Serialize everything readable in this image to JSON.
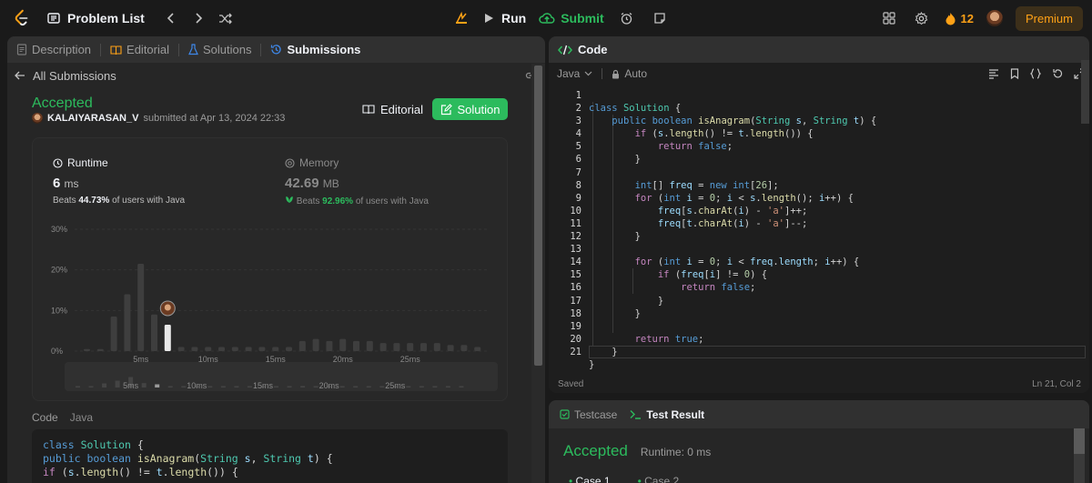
{
  "nav": {
    "problem_list": "Problem List",
    "run": "Run",
    "submit": "Submit",
    "streak": "12",
    "premium": "Premium"
  },
  "left_tabs": [
    "Description",
    "Editorial",
    "Solutions",
    "Submissions"
  ],
  "back_link": "All Submissions",
  "submission": {
    "status": "Accepted",
    "username": "KALAIYARASAN_V",
    "submitted_text": "submitted at Apr 13, 2024 22:33",
    "editorial_btn": "Editorial",
    "solution_btn": "Solution"
  },
  "runtime": {
    "label": "Runtime",
    "value": "6",
    "unit": "ms",
    "beats_prefix": "Beats",
    "beats_pct": "44.73%",
    "beats_suffix": "of users with Java"
  },
  "memory": {
    "label": "Memory",
    "value": "42.69",
    "unit": "MB",
    "beats_prefix": "Beats",
    "beats_pct": "92.96%",
    "beats_suffix": "of users with Java"
  },
  "chart_data": {
    "type": "bar",
    "title": "",
    "xlabel": "",
    "ylabel": "",
    "ylim": [
      0,
      30
    ],
    "y_ticks": [
      "30%",
      "20%",
      "10%",
      "0%"
    ],
    "x_tick_labels": [
      "5ms",
      "10ms",
      "15ms",
      "20ms",
      "25ms"
    ],
    "x": [
      1,
      2,
      3,
      4,
      5,
      6,
      7,
      8,
      9,
      10,
      11,
      12,
      13,
      14,
      15,
      16,
      17,
      18,
      19,
      20,
      21,
      22,
      23,
      24,
      25,
      26,
      27,
      28,
      29,
      30
    ],
    "values": [
      0.5,
      0.5,
      8.5,
      14,
      21.5,
      9,
      6.5,
      1,
      1,
      1,
      1,
      1,
      1,
      1,
      1,
      1,
      2.5,
      3,
      2.5,
      3,
      2.5,
      2.5,
      2,
      2,
      2,
      2,
      2,
      1.5,
      1.5,
      1
    ],
    "highlight_index": 6,
    "highlight_color": "#e8e8e8",
    "bar_color": "#3e3e3e",
    "mini_tick_labels": [
      "5ms",
      "10ms",
      "15ms",
      "20ms",
      "25ms"
    ],
    "grid": true
  },
  "code_section": {
    "tab": "Code",
    "lang": "Java",
    "preview_lines": [
      "class Solution {",
      "    public boolean isAnagram(String s, String t) {",
      "        if (s.length() != t.length()) {"
    ]
  },
  "editor": {
    "title": "Code",
    "language": "Java",
    "mode": "Auto",
    "line_numbers": [
      "1",
      "2",
      "3",
      "4",
      "5",
      "6",
      "7",
      "8",
      "9",
      "10",
      "11",
      "12",
      "13",
      "14",
      "15",
      "16",
      "17",
      "18",
      "19",
      "20",
      "21"
    ],
    "code_lines": [
      "class Solution {",
      "    public boolean isAnagram(String s, String t) {",
      "        if (s.length() != t.length()) {",
      "            return false;",
      "        }",
      "",
      "        int[] freq = new int[26];",
      "        for (int i = 0; i < s.length(); i++) {",
      "            freq[s.charAt(i) - 'a']++;",
      "            freq[t.charAt(i) - 'a']--;",
      "        }",
      "",
      "        for (int i = 0; i < freq.length; i++) {",
      "            if (freq[i] != 0) {",
      "                return false;",
      "            }",
      "        }",
      "",
      "        return true;",
      "    }",
      "}"
    ],
    "saved": "Saved",
    "cursor": "Ln 21, Col 2"
  },
  "result": {
    "tab_testcase": "Testcase",
    "tab_result": "Test Result",
    "status": "Accepted",
    "runtime": "Runtime: 0 ms",
    "cases": [
      "Case 1",
      "Case 2"
    ]
  },
  "colors": {
    "accent_green": "#2cbb5d",
    "accent_orange": "#ffa116",
    "background": "#1a1a1a",
    "panel": "#262626"
  }
}
